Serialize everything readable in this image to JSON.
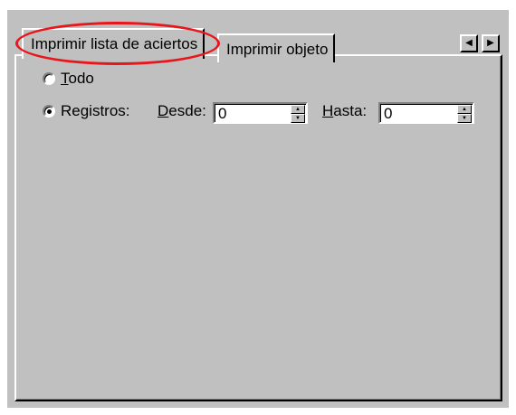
{
  "tabs": {
    "active": {
      "label": "Imprimir lista de aciertos"
    },
    "inactive": {
      "label": "Imprimir objeto"
    }
  },
  "scroll": {
    "left": "◀",
    "right": "▶"
  },
  "options": {
    "todo": {
      "first": "T",
      "rest": "odo",
      "selected": false
    },
    "registros": {
      "label": "Registros:",
      "selected": true
    }
  },
  "desde": {
    "first": "D",
    "rest": "esde:",
    "value": "0"
  },
  "hasta": {
    "first": "H",
    "rest": "asta:",
    "value": "0"
  },
  "spinner": {
    "up": "▲",
    "down": "▼"
  },
  "colors": {
    "highlight": "#e8161b",
    "face": "#c0c0c0"
  }
}
